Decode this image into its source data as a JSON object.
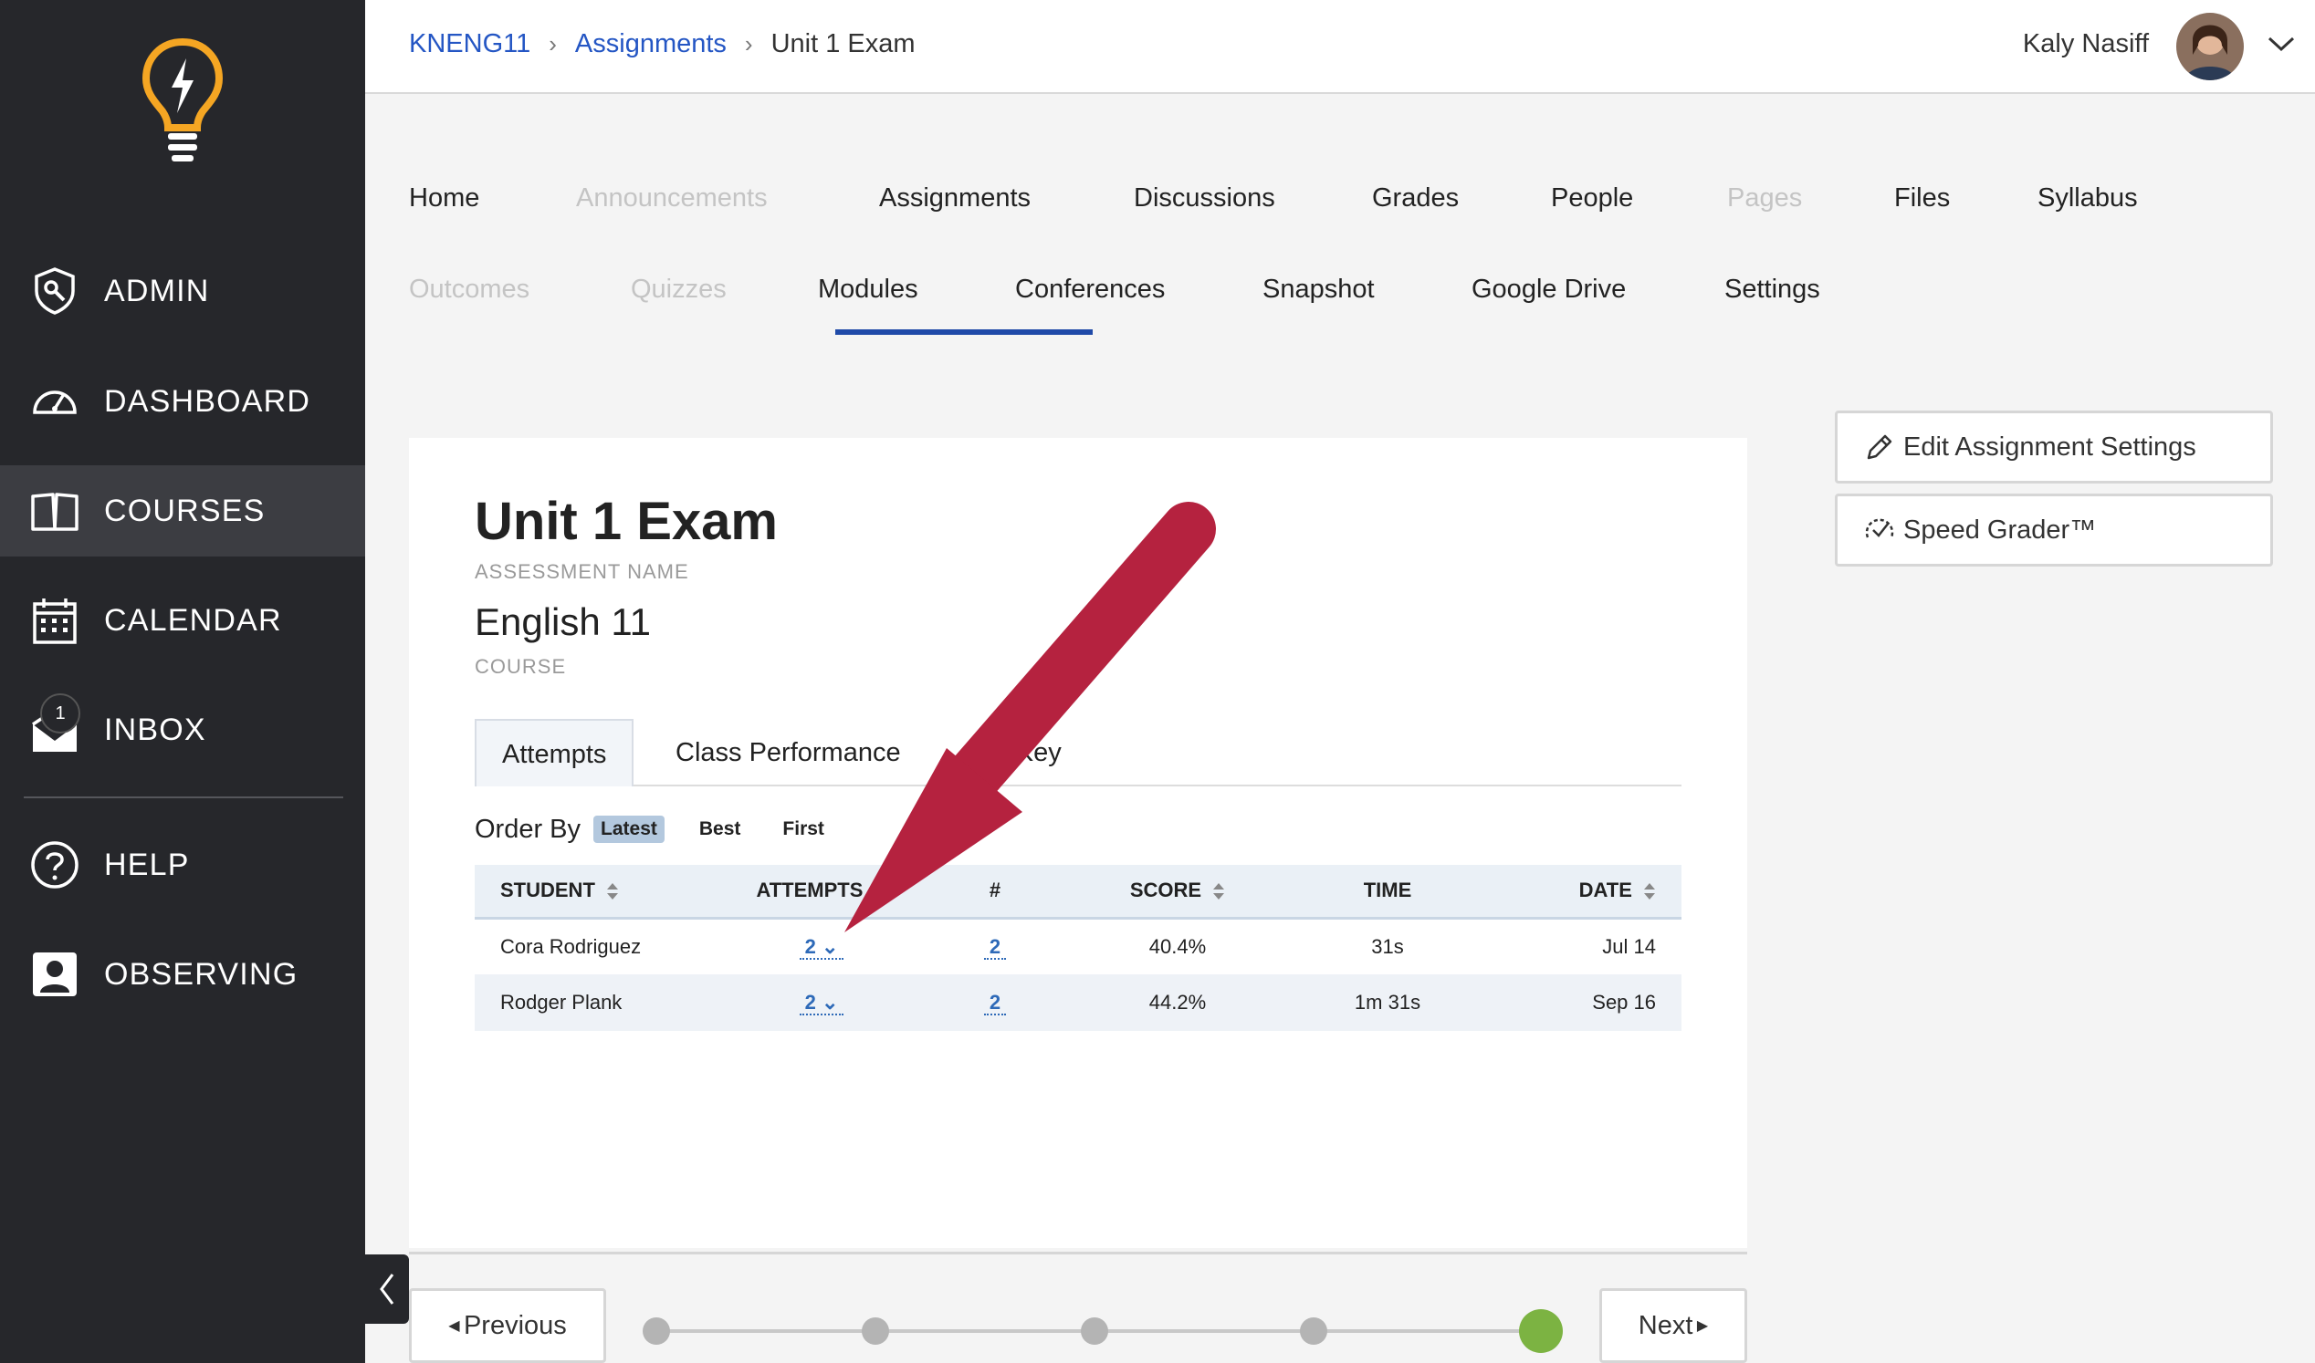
{
  "sidebar": {
    "items": [
      {
        "label": "ADMIN"
      },
      {
        "label": "DASHBOARD"
      },
      {
        "label": "COURSES"
      },
      {
        "label": "CALENDAR"
      },
      {
        "label": "INBOX"
      },
      {
        "label": "HELP"
      },
      {
        "label": "OBSERVING"
      }
    ],
    "inbox_badge": "1",
    "active_item": "COURSES"
  },
  "header": {
    "breadcrumb": [
      "KNENG11",
      "Assignments",
      "Unit 1 Exam"
    ],
    "user_name": "Kaly Nasiff"
  },
  "course_nav": {
    "row1": [
      {
        "label": "Home",
        "disabled": false
      },
      {
        "label": "Announcements",
        "disabled": true
      },
      {
        "label": "Assignments",
        "disabled": false,
        "active": true
      },
      {
        "label": "Discussions",
        "disabled": false
      },
      {
        "label": "Grades",
        "disabled": false
      },
      {
        "label": "People",
        "disabled": false
      },
      {
        "label": "Pages",
        "disabled": true
      },
      {
        "label": "Files",
        "disabled": false
      },
      {
        "label": "Syllabus",
        "disabled": false
      }
    ],
    "row2": [
      {
        "label": "Outcomes",
        "disabled": true
      },
      {
        "label": "Quizzes",
        "disabled": true
      },
      {
        "label": "Modules",
        "disabled": false
      },
      {
        "label": "Conferences",
        "disabled": false
      },
      {
        "label": "Snapshot",
        "disabled": false
      },
      {
        "label": "Google Drive",
        "disabled": false
      },
      {
        "label": "Settings",
        "disabled": false
      }
    ]
  },
  "assessment": {
    "title": "Unit 1 Exam",
    "title_caption": "ASSESSMENT NAME",
    "course": "English 11",
    "course_caption": "COURSE"
  },
  "inner_tabs": {
    "attempts": "Attempts",
    "class_performance": "Class Performance",
    "answer_key": "wer Key"
  },
  "order_by": {
    "label": "Order By",
    "options": [
      "Latest",
      "Best",
      "First"
    ],
    "selected": "Latest"
  },
  "table": {
    "headers": {
      "student": "STUDENT",
      "attempts": "ATTEMPTS",
      "num": "#",
      "score": "SCORE",
      "time": "TIME",
      "date": "DATE"
    },
    "rows": [
      {
        "student": "Cora Rodriguez",
        "attempts": "2",
        "num": "2",
        "score": "40.4%",
        "time": "31s",
        "date": "Jul 14"
      },
      {
        "student": "Rodger Plank",
        "attempts": "2",
        "num": "2",
        "score": "44.2%",
        "time": "1m 31s",
        "date": "Sep 16"
      }
    ]
  },
  "side_buttons": {
    "edit_settings": "Edit Assignment Settings",
    "speed_grader": "Speed Grader™"
  },
  "pager": {
    "previous": "Previous",
    "next": "Next",
    "total_steps": 5,
    "current_step": 5
  },
  "colors": {
    "sidebar_bg": "#26272b",
    "link_blue": "#2456c4",
    "tab_underline": "#1f4aa8",
    "annotation_arrow": "#b5223f",
    "progress_current": "#7cb342"
  }
}
